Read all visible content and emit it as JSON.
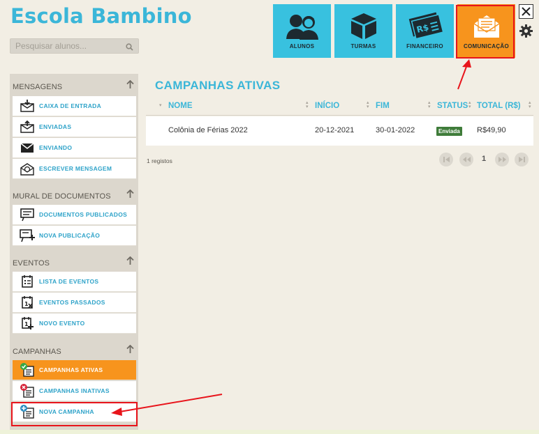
{
  "app": {
    "title": "Escola Bambino"
  },
  "search": {
    "placeholder": "Pesquisar alunos..."
  },
  "tiles": [
    {
      "label": "ALUNOS",
      "icon": "students-icon"
    },
    {
      "label": "TURMAS",
      "icon": "box-icon"
    },
    {
      "label": "FINANCEIRO",
      "icon": "money-icon"
    },
    {
      "label": "COMUNICAÇÃO",
      "icon": "envelope-icon",
      "active": true
    }
  ],
  "sidebar": {
    "sections": [
      {
        "title": "MENSAGENS",
        "items": [
          {
            "label": "CAIXA DE ENTRADA"
          },
          {
            "label": "ENVIADAS"
          },
          {
            "label": "ENVIANDO"
          },
          {
            "label": "ESCREVER MENSAGEM"
          }
        ]
      },
      {
        "title": "MURAL DE DOCUMENTOS",
        "items": [
          {
            "label": "DOCUMENTOS PUBLICADOS"
          },
          {
            "label": "NOVA PUBLICAÇÃO"
          }
        ]
      },
      {
        "title": "EVENTOS",
        "items": [
          {
            "label": "LISTA DE EVENTOS"
          },
          {
            "label": "EVENTOS PASSADOS"
          },
          {
            "label": "NOVO EVENTO"
          }
        ]
      },
      {
        "title": "CAMPANHAS",
        "items": [
          {
            "label": "CAMPANHAS ATIVAS",
            "active": true
          },
          {
            "label": "CAMPANHAS INATIVAS"
          },
          {
            "label": "NOVA CAMPANHA"
          }
        ]
      }
    ]
  },
  "main": {
    "title": "CAMPANHAS ATIVAS",
    "columns": [
      "NOME",
      "INÍCIO",
      "FIM",
      "STATUS",
      "TOTAL (R$)"
    ],
    "rows": [
      {
        "nome": "Colônia de Férias 2022",
        "inicio": "20-12-2021",
        "fim": "30-01-2022",
        "status": "Enviada",
        "total": "R$49,90"
      }
    ],
    "records": "1 registos",
    "current_page": "1"
  },
  "colors": {
    "accent_blue": "#38c1df",
    "accent_orange": "#f7941d",
    "highlight_red": "#e8141b",
    "status_green": "#3f7c3a"
  }
}
